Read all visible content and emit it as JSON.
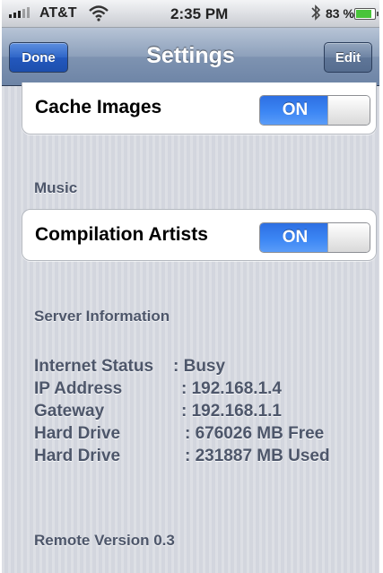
{
  "status_bar": {
    "carrier": "AT&T",
    "time": "2:35 PM",
    "battery_percent": "83 %",
    "battery_level": 0.83,
    "signal_icon": "signal-bars-icon",
    "wifi_icon": "wifi-icon",
    "bluetooth_icon": "bluetooth-icon",
    "battery_icon": "battery-icon"
  },
  "nav_bar": {
    "title": "Settings",
    "left_button": "Done",
    "right_button": "Edit"
  },
  "settings": {
    "cache_images": {
      "label": "Cache Images",
      "switch_text": "ON",
      "on": true
    },
    "music_section": "Music",
    "compilation_artists": {
      "label": "Compilation Artists",
      "switch_text": "ON",
      "on": true
    }
  },
  "server_info": {
    "header": "Server Information",
    "rows": [
      {
        "label": "Internet Status",
        "value": ": Busy"
      },
      {
        "label": "IP Address",
        "value": ": 192.168.1.4"
      },
      {
        "label": "Gateway",
        "value": ": 192.168.1.1"
      },
      {
        "label": "Hard Drive",
        "value": ": 676026 MB Free"
      },
      {
        "label": "Hard Drive",
        "value": ": 231887 MB Used"
      }
    ]
  },
  "remote_version": "Remote Version 0.3",
  "colors": {
    "switch_on_blue": "#3c86f4",
    "done_button_blue": "#2f66c8",
    "navbar_blue_gray": "#7e93b1",
    "section_text": "#4d566a",
    "battery_green": "#49c43a"
  }
}
